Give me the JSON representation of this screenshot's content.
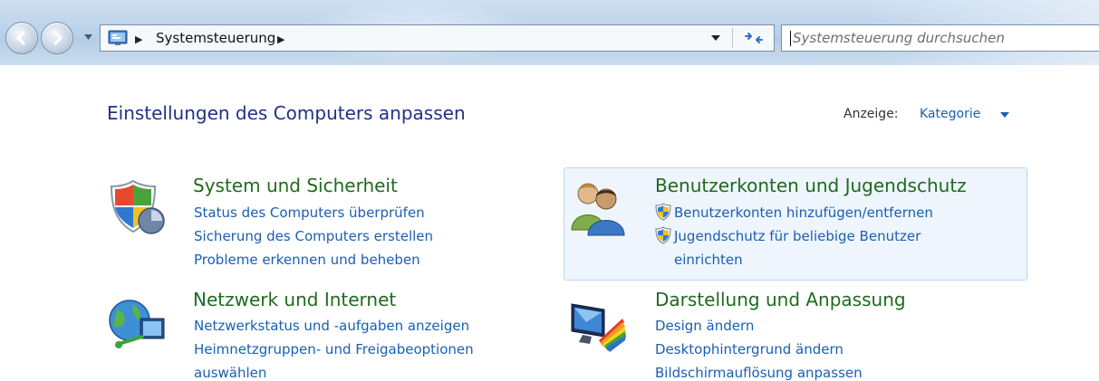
{
  "address_bar": {
    "breadcrumb": "Systemsteuerung",
    "search_placeholder": "Systemsteuerung durchsuchen"
  },
  "header": {
    "title": "Einstellungen des Computers anpassen",
    "view_label": "Anzeige:",
    "view_value": "Kategorie"
  },
  "categories": {
    "system": {
      "title": "System und Sicherheit",
      "links": [
        "Status des Computers überprüfen",
        "Sicherung des Computers erstellen",
        "Probleme erkennen und beheben"
      ],
      "icon": "security-shield-icon"
    },
    "network": {
      "title": "Netzwerk und Internet",
      "links": [
        "Netzwerkstatus und -aufgaben anzeigen",
        "Heimnetzgruppen- und Freigabeoptionen",
        "auswählen"
      ],
      "icon": "network-globe-icon"
    },
    "users": {
      "title": "Benutzerkonten und Jugendschutz",
      "links": [
        "Benutzerkonten hinzufügen/entfernen",
        "Jugendschutz für beliebige Benutzer",
        "einrichten"
      ],
      "icon": "users-icon"
    },
    "appearance": {
      "title": "Darstellung und Anpassung",
      "links": [
        "Design ändern",
        "Desktophintergrund ändern",
        "Bildschirmauflösung anpassen"
      ],
      "icon": "monitor-colors-icon"
    }
  },
  "colors": {
    "category_title": "#1e6b1e",
    "link": "#1a5fb4",
    "heading": "#1e3287",
    "hover_background": "#eef5fd"
  }
}
